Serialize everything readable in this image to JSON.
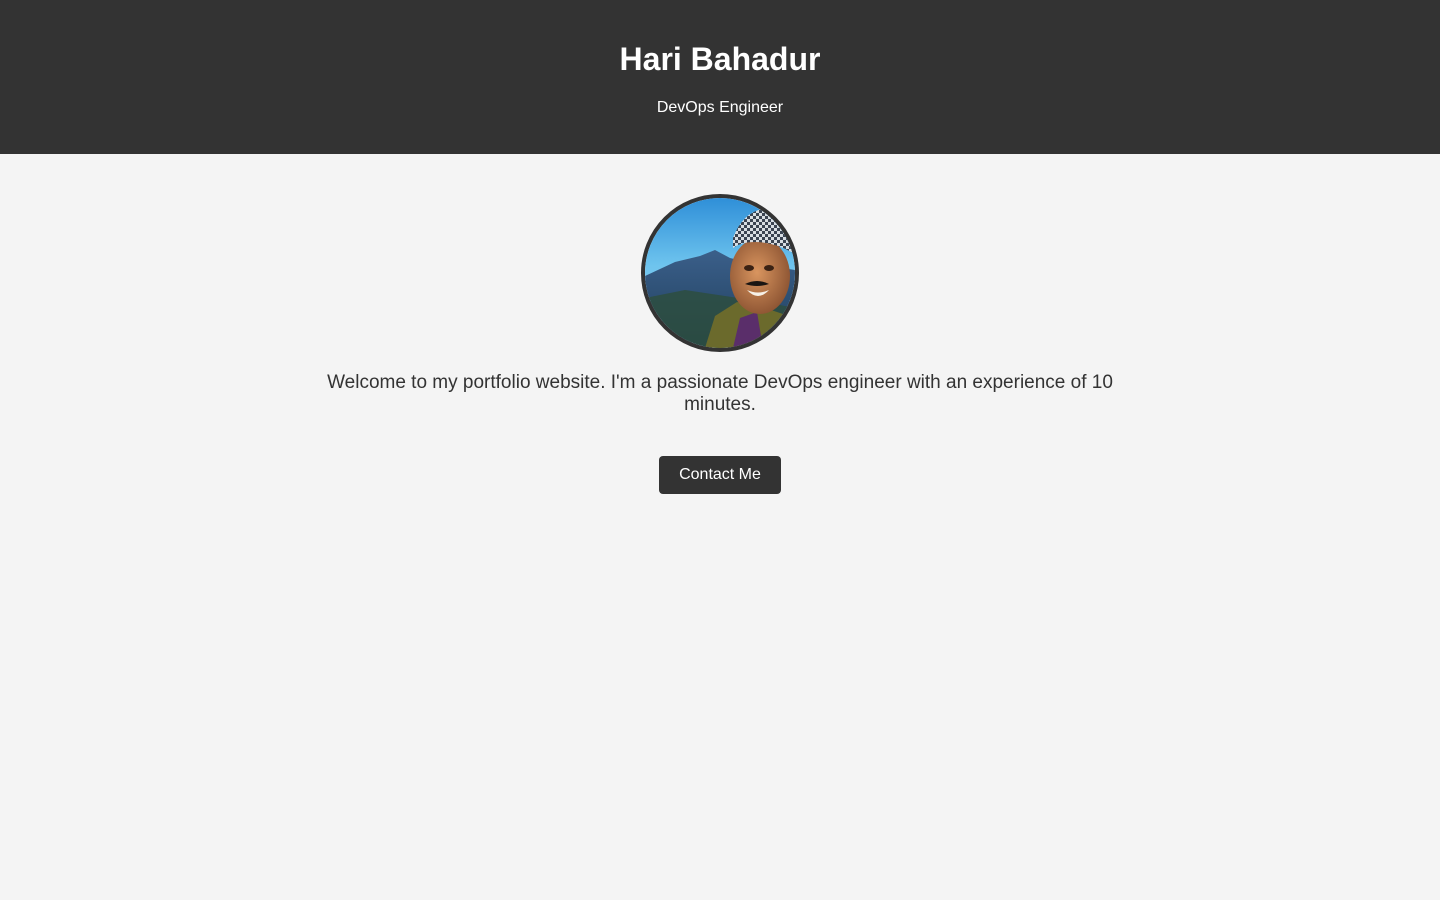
{
  "header": {
    "name": "Hari Bahadur",
    "title": "DevOps Engineer"
  },
  "main": {
    "intro": "Welcome to my portfolio website. I'm a passionate DevOps engineer with an experience of 10 minutes.",
    "contact_label": "Contact Me"
  },
  "colors": {
    "header_bg": "#333333",
    "page_bg": "#f4f4f4",
    "button_bg": "#333333",
    "text": "#333333"
  }
}
